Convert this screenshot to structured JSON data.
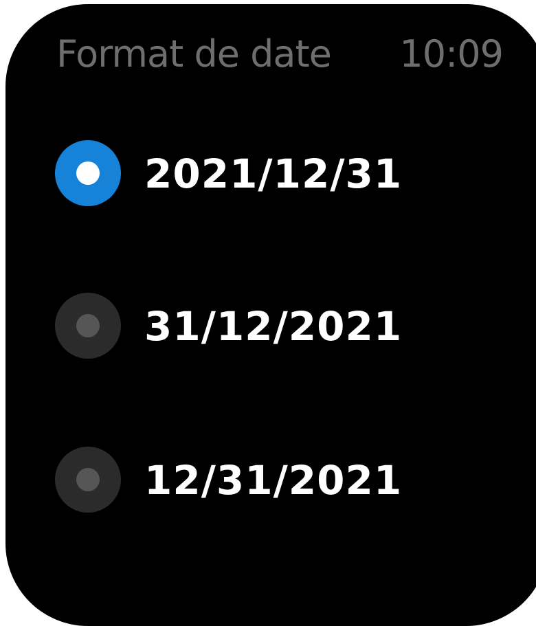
{
  "header": {
    "title": "Format de date",
    "time": "10:09"
  },
  "options": [
    {
      "label": "2021/12/31",
      "selected": true
    },
    {
      "label": "31/12/2021",
      "selected": false
    },
    {
      "label": "12/31/2021",
      "selected": false
    }
  ],
  "colors": {
    "background": "#000000",
    "accent": "#1683d9",
    "header_text": "#6e6e6e",
    "option_text": "#ffffff",
    "radio_inactive": "#2b2b2b"
  }
}
